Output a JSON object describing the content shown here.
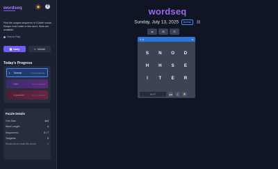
{
  "app": {
    "logo": "wordseq",
    "title": "wordseq",
    "date": "Sunday, July 13, 2025",
    "badge": "Normal"
  },
  "sidebar": {
    "intro": "Find the longest sequence of 4-letter words. Swaps must make a new word. Hints are available.",
    "how_to_play": "How to Play",
    "modes": {
      "daily": "Daily",
      "infinite": "Infinite"
    },
    "progress_title": "Today's Progress",
    "progress_items": [
      {
        "label": "Normal",
        "status": "Not completed"
      },
      {
        "label": "Hard",
        "status": "Not completed"
      },
      {
        "label": "Impossible",
        "status": "Not completed"
      }
    ],
    "details": {
      "title": "Puzzle Details",
      "rows": [
        {
          "label": "Grid Size:",
          "value": "4x3"
        },
        {
          "label": "Word Length:",
          "value": "4"
        },
        {
          "label": "Sequenced:",
          "value": "0 / 7"
        },
        {
          "label": "Tangents:",
          "value": "3"
        }
      ],
      "footer_label": "Words solved made this puzzle",
      "footer_value": "0"
    }
  },
  "toolbar": {
    "buttons": [
      "⇆",
      "⊞",
      "⊟"
    ]
  },
  "game": {
    "head_left": "4",
    "head_right": "⇥",
    "grid": [
      [
        "S",
        "N",
        "O",
        "D"
      ],
      [
        "H",
        "H",
        "S",
        "E"
      ],
      [
        "I",
        "T",
        "E",
        "R"
      ]
    ],
    "count": "0 / 7",
    "foot_buttons": [
      "◀◀",
      "II",
      "💡"
    ]
  },
  "colors": {
    "background": "#0f1522",
    "sidebar": "#1b2130",
    "accent": "#9b66f2",
    "primary": "#6f5cf0",
    "panel_header": "#2d74d6"
  }
}
